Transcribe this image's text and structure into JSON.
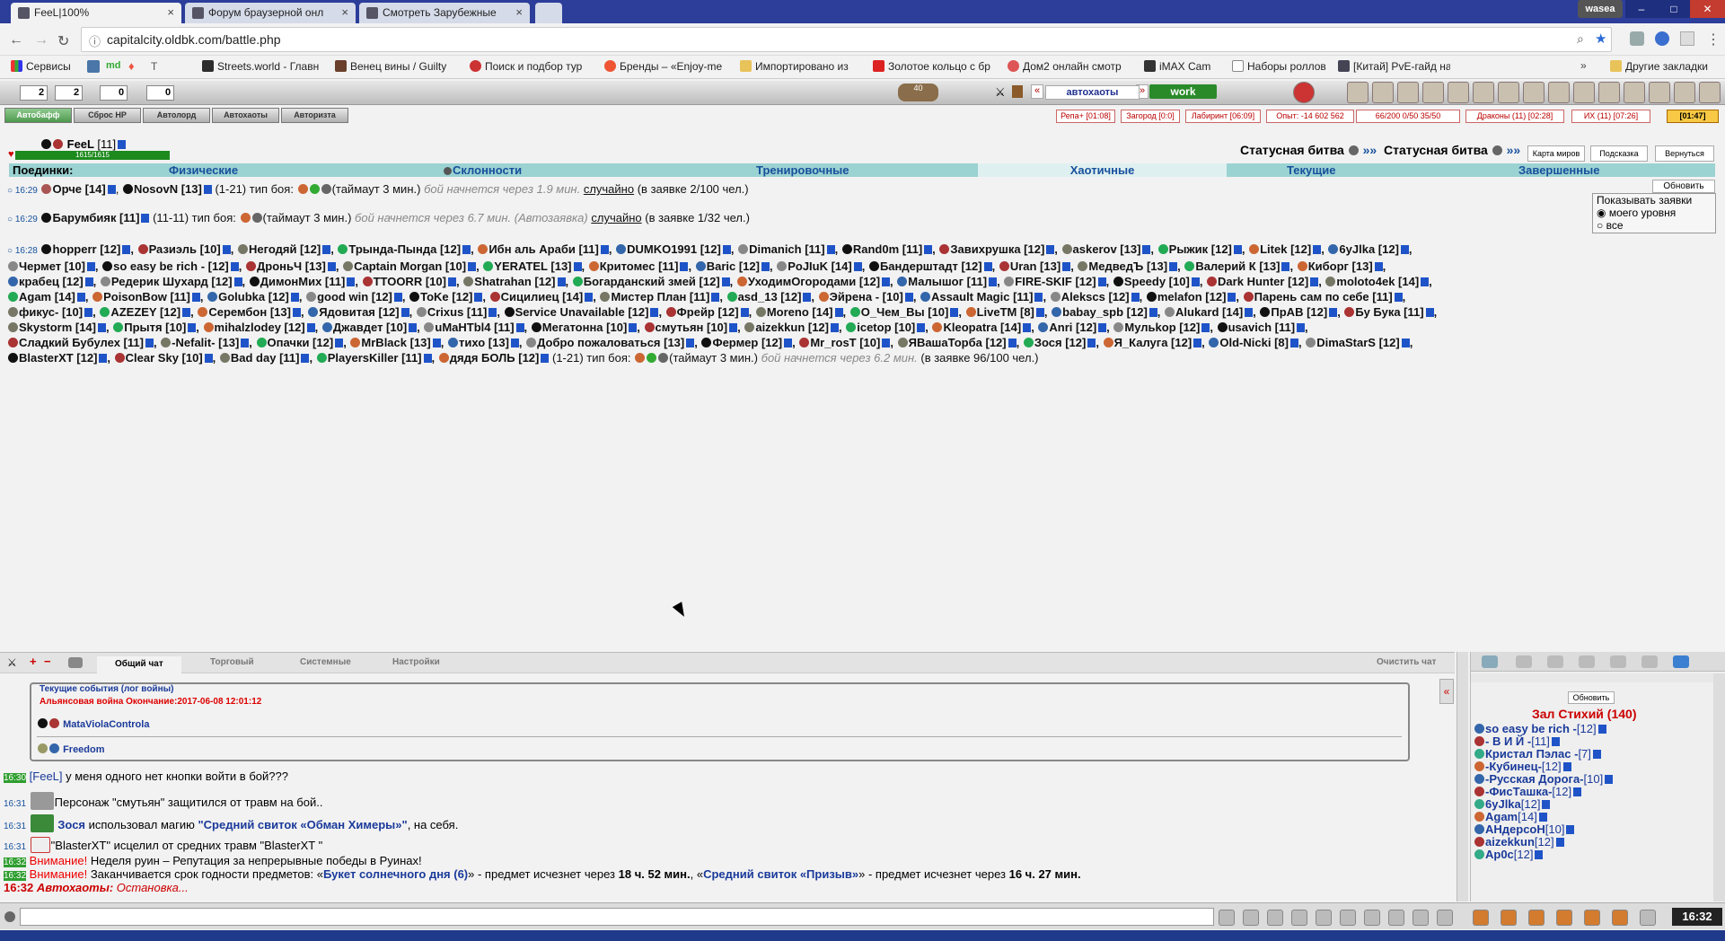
{
  "browser": {
    "tabs": [
      {
        "label": "FeeL|100%"
      },
      {
        "label": "Форум браузерной онл"
      },
      {
        "label": "Смотреть Зарубежные"
      }
    ],
    "profile": "wasea",
    "url": "capitalcity.oldbk.com/battle.php",
    "bookmarks": [
      "Сервисы",
      "Streets.world - Главн",
      "Венец вины / Guilty",
      "Поиск и подбор тур",
      "Бренды – «Enjoy-me",
      "Импортировано из",
      "Золотое кольцо с бр",
      "Дом2 онлайн смотр",
      "iMAX Cam",
      "Наборы роллов",
      "[Китай] PvE-гайд на"
    ],
    "other_bookmarks": "Другие закладки",
    "bookmark_extras": [
      "md",
      "T"
    ]
  },
  "gamebar": {
    "counters": [
      "2",
      "2",
      "0",
      "0"
    ],
    "level_badge": "40",
    "autohaot": "автохаоты",
    "work": "work",
    "arrows": [
      "«",
      "»"
    ]
  },
  "actionbar": {
    "buttons": [
      "Автобафф",
      "Сброс HP",
      "Автолорд",
      "Автохаоты",
      "Авторизта"
    ],
    "stats": [
      "Репа+ [01:08]",
      "Загород [0:0]",
      "Лабиринт [06:09]",
      "Опыт: -14 602 562",
      "66/200 0/50 35/50",
      "Драконы (11) [02:28]",
      "ИХ (11) [07:26]",
      "[01:47]"
    ]
  },
  "player": {
    "name": "FeeL",
    "level": "[11]",
    "hp": "1615/1615"
  },
  "status_battle": {
    "label1": "Статусная битва",
    "label2": "Статусная битва",
    "arrows": "»»",
    "buttons": [
      "Карта миров",
      "Подсказка",
      "Вернуться"
    ]
  },
  "categories": [
    "Поединки:",
    "Физические",
    "Склонности",
    "Тренировочные",
    "Хаотичные",
    "Текущие",
    "Завершенные"
  ],
  "refresh": "Обновить",
  "show_requests": {
    "title": "Показывать заявки",
    "opt1": "моего уровня",
    "opt2": "все"
  },
  "requests": [
    {
      "time": "16:29",
      "text1": "Орче [14]",
      "text2": "NosovN [13]",
      "text3": "(1-21)   тип боя:",
      "text4": "(таймаут 3 мин.)",
      "pending": "бой начнется через 1.9 мин.",
      "link": "случайно",
      "tail": "(в заявке 2/100 чел.)"
    },
    {
      "time": "16:29",
      "text1": "Барумбияк [11]",
      "text2": "(11-11)   тип боя:",
      "text3": "(таймаут 3 мин.)",
      "pending": "бой начнется через 6.7 мин. (Автозаявка)",
      "link": "случайно",
      "tail": "(в заявке 1/32 чел.)"
    }
  ],
  "chaos": {
    "time": "16:28",
    "players": [
      "hopperr [12]",
      "Разиэль [10]",
      "Негодяй [12]",
      "Трында-Пында [12]",
      "Ибн аль Араби [11]",
      "DUMKO1991 [12]",
      "Dimanich [11]",
      "Rand0m [11]",
      "Завихрушка [12]",
      "askerov [13]",
      "Рыжик [12]",
      "Litek [12]",
      "6yJlka [12]",
      "Чермет [10]",
      "so easy be rich - [12]",
      "ДроньЧ [13]",
      "Captain Morgan [10]",
      "YERATEL [13]",
      "Критомес [11]",
      "Baric [12]",
      "PoJIuK [14]",
      "Бандерштадт [12]",
      "Uran [13]",
      "МедведЪ [13]",
      "Валерий К [13]",
      "Киборг [13]",
      "крабец [12]",
      "Редерик Шухард [12]",
      "ДимонМих [11]",
      "TTOORR [10]",
      "Shatrahan [12]",
      "Богарданский змей [12]",
      "УходимОгородами [12]",
      "Малышог [11]",
      "FIRE-SKIF [12]",
      "Speedy [10]",
      "Dark Hunter [12]",
      "moloto4ek [14]",
      "Agam [14]",
      "PoisonBow [11]",
      "Golubka [12]",
      "good win [12]",
      "ToKe [12]",
      "Сицилиец [14]",
      "Мистер План [11]",
      "asd_13 [12]",
      "Эйрена - [10]",
      "Assault Magic [11]",
      "Alekscs [12]",
      "melafon [12]",
      "Парень сам по себе [11]",
      "фикус- [10]",
      "AZEZEY [12]",
      "Серембон [13]",
      "Ядовитая [12]",
      "Crixus [11]",
      "Service Unavailable [12]",
      "Фрейр [12]",
      "Moreno [14]",
      "О_Чем_Вы [10]",
      "LiveTM [8]",
      "babay_spb [12]",
      "Alukard [14]",
      "ПрАВ [12]",
      "Бу Бука [11]",
      "Skystorm [14]",
      "Прытя [10]",
      "mihalzlodey [12]",
      "Джавдет [10]",
      "uMaHTbl4 [11]",
      "Мегатонна [10]",
      "смутьян [10]",
      "aizekkun [12]",
      "icetop [10]",
      "Kleopatra [14]",
      "Anri [12]",
      "Мульkop [12]",
      "usavich [11]",
      "Сладкий Бубулех [11]",
      "-Nefalit- [13]",
      "Опачки [12]",
      "MrBlack [13]",
      "тихо [13]",
      "Добро пожаловаться [13]",
      "Фермер [12]",
      "Mr_rosT [10]",
      "ЯВашаТорба [12]",
      "Зося [12]",
      "Я_Калуга [12]",
      "Old-Nicki [8]",
      "DimaStarS [12]",
      "BlasterXT [12]",
      "Clear Sky [10]",
      "Bad day [11]",
      "PlayersKiller [11]",
      "дядя БОЛЬ [12]"
    ],
    "range": "(1-21)   тип боя:",
    "timeout": "(таймаут 3 мин.)",
    "pending": "бой начнется через 6.2 мин.",
    "tail": "(в заявке 96/100 чел.)"
  },
  "chat": {
    "tabs": [
      "Общий чат",
      "Торговый",
      "Системные",
      "Настройки"
    ],
    "clear": "Очистить чат",
    "events_title": "Текущие события (лог войны)",
    "war": "Альянсовая война Окончание:2017-06-08 12:01:12",
    "clan1": "MataViolaControla",
    "clan2": "Freedom",
    "lines": [
      {
        "time": "16:30",
        "a": "[FeeL]",
        "b": " у меня одного нет кнопки войти в бой???"
      },
      {
        "time": "16:31",
        "a": "",
        "b": "Персонаж \"смутьян\" защитился от травм на бой.."
      },
      {
        "time": "16:31",
        "a": "Зося",
        "b": " использовал магию ",
        "c": "\"Средний свиток «Обман Химеры»\"",
        "d": ", на себя."
      },
      {
        "time": "16:31",
        "a": "",
        "b": "\"BlasterXT\" исцелил от средних травм \"BlasterXT \""
      },
      {
        "time": "16:32",
        "a": "Внимание!",
        "b": " Неделя руин – Репутация за непрерывные победы в Руинах!"
      },
      {
        "time": "16:32",
        "a": "Внимание!",
        "b": " Заканчивается срок годности предметов: «",
        "c": "Букет солнечного дня (6)",
        "d": "» - предмет исчезнет через ",
        "e": "18 ч. 52 мин.",
        "f": ", «",
        "g": "Средний свиток «Призыв»",
        "h": "» - предмет исчезнет через ",
        "i": "16 ч. 27 мин."
      },
      {
        "time": "16:32",
        "a": "Автохаоты:",
        "b": " Остановка..."
      }
    ]
  },
  "room": {
    "refresh": "Обновить",
    "title": "Зал Стихий (140)",
    "users": [
      {
        "name": "so easy be rich -",
        "lv": "[12]"
      },
      {
        "name": "- В И Й -",
        "lv": "[11]"
      },
      {
        "name": "Кристал Пэлас -",
        "lv": "[7]"
      },
      {
        "name": "-Кубинец-",
        "lv": "[12]"
      },
      {
        "name": "-Русская Дорога-",
        "lv": "[10]"
      },
      {
        "name": "-ФисТашка-",
        "lv": "[12]"
      },
      {
        "name": "6yJlka",
        "lv": "[12]"
      },
      {
        "name": "Agam",
        "lv": "[14]"
      },
      {
        "name": "АНдерсоН",
        "lv": "[10]"
      },
      {
        "name": "aizekkun",
        "lv": "[12]"
      },
      {
        "name": "Ap0c",
        "lv": "[12]"
      }
    ]
  },
  "clock": "16:32"
}
